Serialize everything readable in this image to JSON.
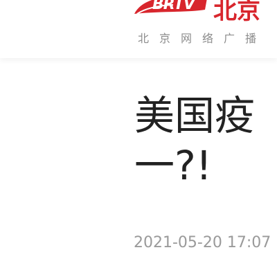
{
  "header": {
    "logo_text": "BRTV",
    "logo_cn": "北京",
    "tagline": "北京网络广播",
    "brand_color": "#d8262d"
  },
  "article": {
    "title_line1": "美国疫",
    "title_line2": "一?!",
    "timestamp": "2021-05-20 17:07"
  }
}
